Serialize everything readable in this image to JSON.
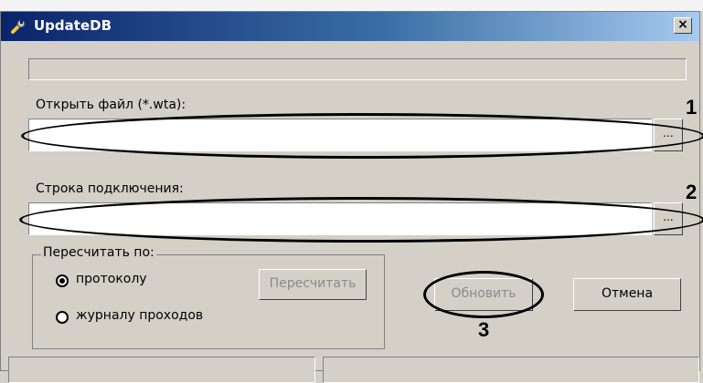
{
  "window": {
    "title": "UpdateDB",
    "close_label": "×"
  },
  "file": {
    "label": "Открыть файл (*.wta):",
    "value": "",
    "browse_label": "..."
  },
  "connection": {
    "label": "Строка подключения:",
    "value": "",
    "browse_label": "..."
  },
  "recalc": {
    "legend": "Пересчитать по:",
    "options": [
      {
        "label": "протоколу",
        "selected": true
      },
      {
        "label": "журналу проходов",
        "selected": false
      }
    ],
    "button_label": "Пересчитать"
  },
  "actions": {
    "update_label": "Обновить",
    "cancel_label": "Отмена"
  },
  "annotations": [
    "1",
    "2",
    "3"
  ],
  "colors": {
    "face": "#d4d0c8",
    "title_start": "#0a246a",
    "title_end": "#a6caf0"
  }
}
